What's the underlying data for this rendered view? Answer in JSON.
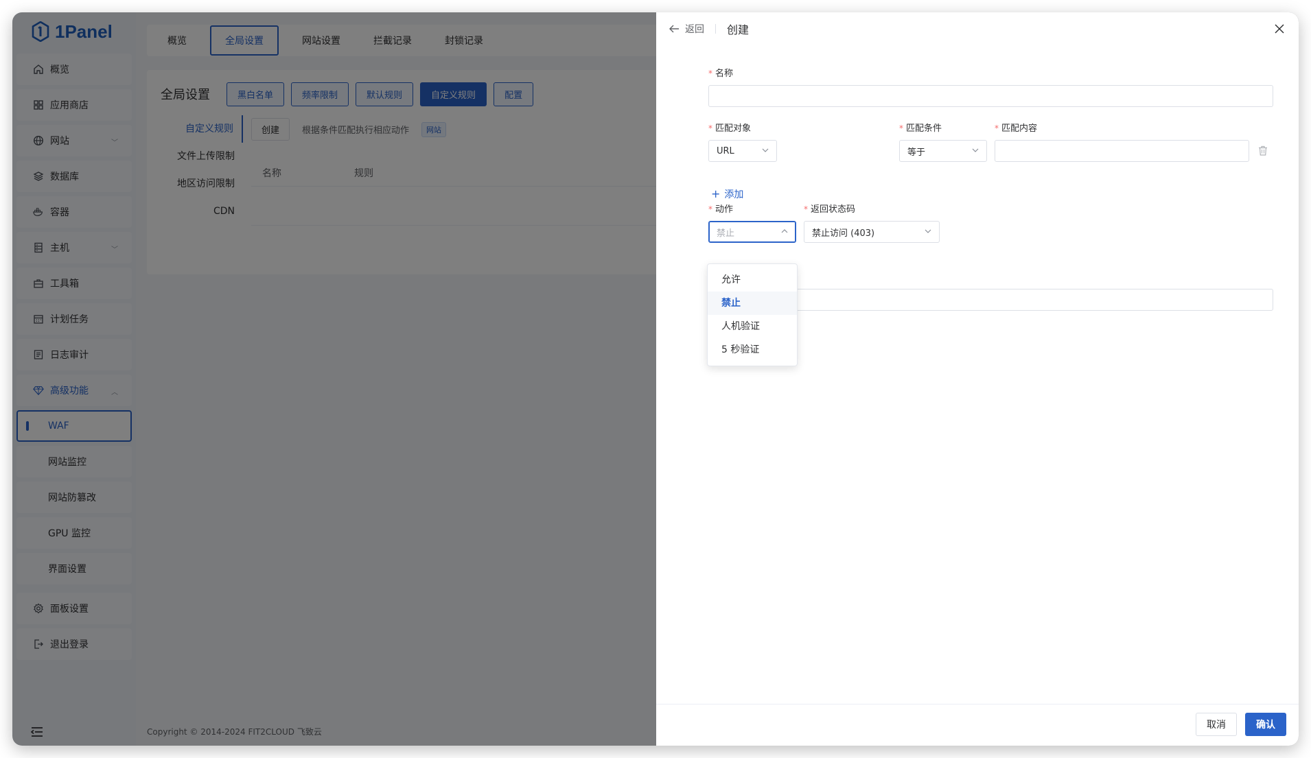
{
  "app": {
    "logo_text": "1Panel"
  },
  "sidebar": {
    "items": [
      {
        "label": "概览",
        "icon": "home-icon"
      },
      {
        "label": "应用商店",
        "icon": "grid-icon"
      },
      {
        "label": "网站",
        "icon": "globe-icon"
      },
      {
        "label": "数据库",
        "icon": "layers-icon"
      },
      {
        "label": "容器",
        "icon": "docker-icon"
      },
      {
        "label": "主机",
        "icon": "server-icon"
      },
      {
        "label": "工具箱",
        "icon": "toolbox-icon"
      },
      {
        "label": "计划任务",
        "icon": "calendar-icon"
      },
      {
        "label": "日志审计",
        "icon": "log-icon"
      },
      {
        "label": "高级功能",
        "icon": "diamond-icon"
      }
    ],
    "sub_items": [
      {
        "label": "WAF"
      },
      {
        "label": "网站监控"
      },
      {
        "label": "网站防篡改"
      },
      {
        "label": "GPU 监控"
      },
      {
        "label": "界面设置"
      }
    ],
    "bottom_items": [
      {
        "label": "面板设置",
        "icon": "gear-icon"
      },
      {
        "label": "退出登录",
        "icon": "logout-icon"
      }
    ]
  },
  "main": {
    "tabs": [
      "概览",
      "全局设置",
      "网站设置",
      "拦截记录",
      "封锁记录"
    ],
    "panel_title": "全局设置",
    "panel_buttons": [
      "黑白名单",
      "频率限制",
      "默认规则",
      "自定义规则",
      "配置"
    ],
    "side_menu": [
      "自定义规则",
      "文件上传限制",
      "地区访问限制",
      "CDN"
    ],
    "create_button": "创建",
    "description": "根据条件匹配执行相应动作",
    "tag": "网站",
    "table_headers": [
      "名称",
      "规则"
    ],
    "copyright": "Copyright © 2014-2024 FIT2CLOUD 飞致云"
  },
  "drawer": {
    "back_label": "返回",
    "title": "创建",
    "name_label": "名称",
    "name_value": "",
    "match_object_label": "匹配对象",
    "match_object_value": "URL",
    "match_condition_label": "匹配条件",
    "match_condition_value": "等于",
    "match_content_label": "匹配内容",
    "match_content_value": "",
    "add_label": "添加",
    "action_label": "动作",
    "action_placeholder": "禁止",
    "status_code_label": "返回状态码",
    "status_code_value": "禁止访问 (403)",
    "action_options": [
      "允许",
      "禁止",
      "人机验证",
      "5 秒验证"
    ],
    "selected_action": "禁止",
    "cancel_label": "取消",
    "confirm_label": "确认"
  },
  "colors": {
    "primary": "#2b63c9",
    "required": "#f56c6c"
  }
}
